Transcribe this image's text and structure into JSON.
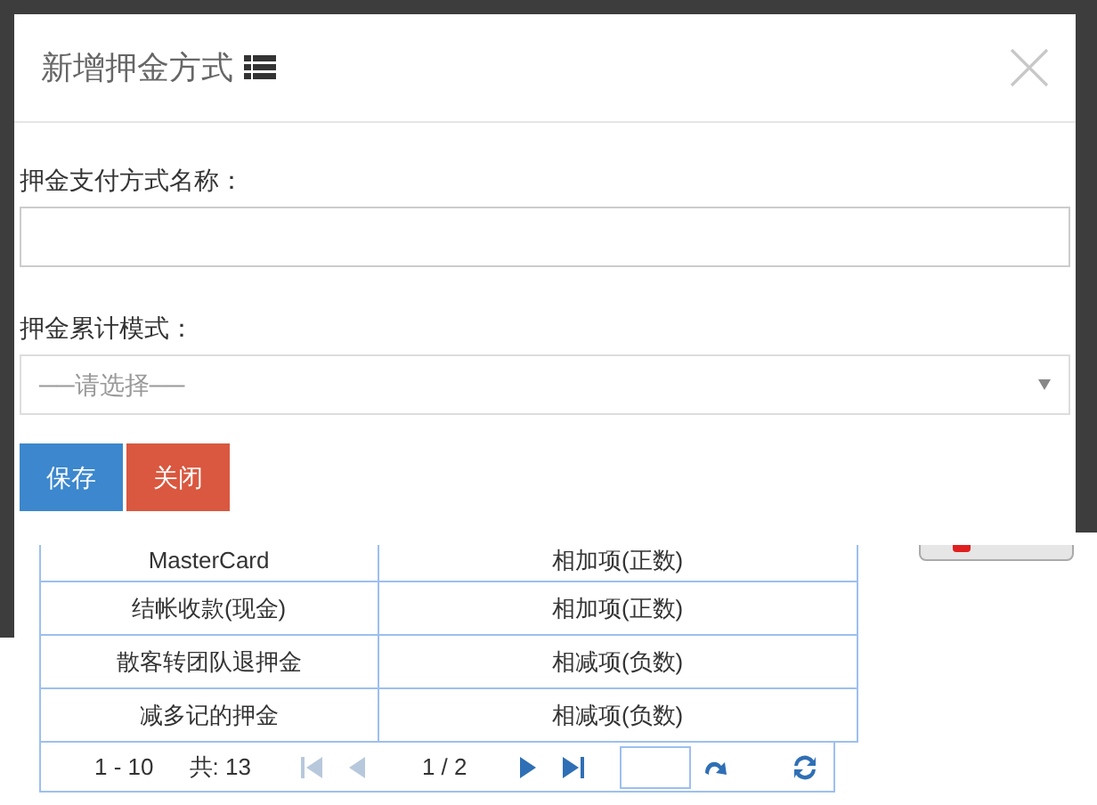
{
  "dialog": {
    "title": "新增押金方式",
    "fields": [
      {
        "kind": "text",
        "label": "押金支付方式名称："
      },
      {
        "kind": "select",
        "label": "押金累计模式：",
        "placeholder": "──请选择──"
      }
    ],
    "buttons": [
      {
        "kind": "primary",
        "label": "保存"
      },
      {
        "kind": "danger",
        "label": "关闭"
      }
    ]
  },
  "table": {
    "rows": [
      [
        "MasterCard",
        "相加项(正数)"
      ],
      [
        "结帐收款(现金)",
        "相加项(正数)"
      ],
      [
        "散客转团队退押金",
        "相减项(负数)"
      ],
      [
        "减多记的押金",
        "相减项(负数)"
      ]
    ]
  },
  "pager": {
    "range": "1 - 10",
    "total": "共: 13",
    "page": "1 / 2",
    "nav": [
      {
        "kind": "first",
        "disabled": true
      },
      {
        "kind": "prev",
        "disabled": true
      },
      {
        "kind": "next",
        "disabled": false
      },
      {
        "kind": "last",
        "disabled": false
      }
    ]
  }
}
